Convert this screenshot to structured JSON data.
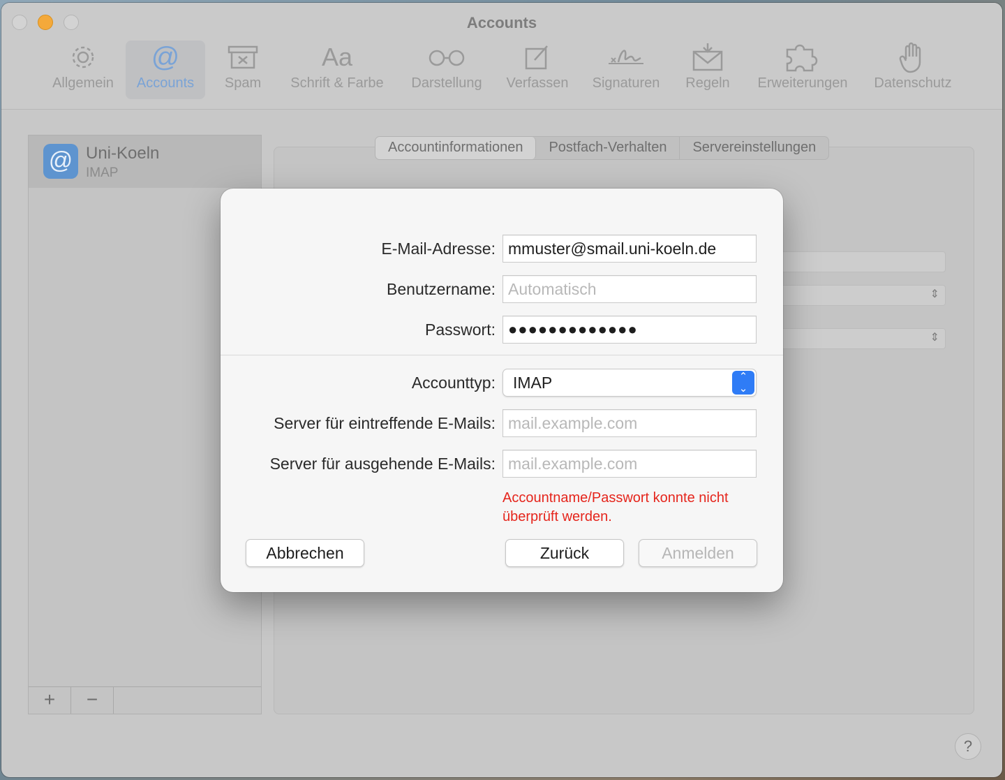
{
  "window": {
    "title": "Accounts"
  },
  "toolbar": {
    "items": [
      {
        "label": "Allgemein",
        "icon": "gear-icon"
      },
      {
        "label": "Accounts",
        "icon": "at-icon"
      },
      {
        "label": "Spam",
        "icon": "junk-icon"
      },
      {
        "label": "Schrift & Farbe",
        "icon": "font-icon"
      },
      {
        "label": "Darstellung",
        "icon": "glasses-icon"
      },
      {
        "label": "Verfassen",
        "icon": "compose-icon"
      },
      {
        "label": "Signaturen",
        "icon": "signature-icon"
      },
      {
        "label": "Regeln",
        "icon": "rules-icon"
      },
      {
        "label": "Erweiterungen",
        "icon": "puzzle-icon"
      },
      {
        "label": "Datenschutz",
        "icon": "hand-icon"
      }
    ],
    "active": "Accounts",
    "accent_color": "#7aa3d6"
  },
  "sidebar": {
    "accounts": [
      {
        "name": "Uni-Koeln",
        "type": "IMAP",
        "icon": "at-icon"
      }
    ],
    "add_label": "+",
    "remove_label": "−"
  },
  "tabs": [
    {
      "label": "Accountinformationen",
      "selected": true
    },
    {
      "label": "Postfach-Verhalten",
      "selected": false
    },
    {
      "label": "Servereinstellungen",
      "selected": false
    }
  ],
  "dialog": {
    "email_label": "E-Mail-Adresse:",
    "email_value": "mmuster@smail.uni-koeln.de",
    "username_label": "Benutzername:",
    "username_placeholder": "Automatisch",
    "password_label": "Passwort:",
    "password_value": "●●●●●●●●●●●●●",
    "account_type_label": "Accounttyp:",
    "account_type_value": "IMAP",
    "incoming_label": "Server für eintreffende E-Mails:",
    "incoming_placeholder": "mail.example.com",
    "outgoing_label": "Server für ausgehende E-Mails:",
    "outgoing_placeholder": "mail.example.com",
    "error_message": "Accountname/Passwort konnte nicht überprüft werden.",
    "error_color": "#e5251c",
    "cancel_label": "Abbrechen",
    "back_label": "Zurück",
    "signin_label": "Anmelden",
    "signin_enabled": false
  },
  "help": {
    "label": "?"
  }
}
